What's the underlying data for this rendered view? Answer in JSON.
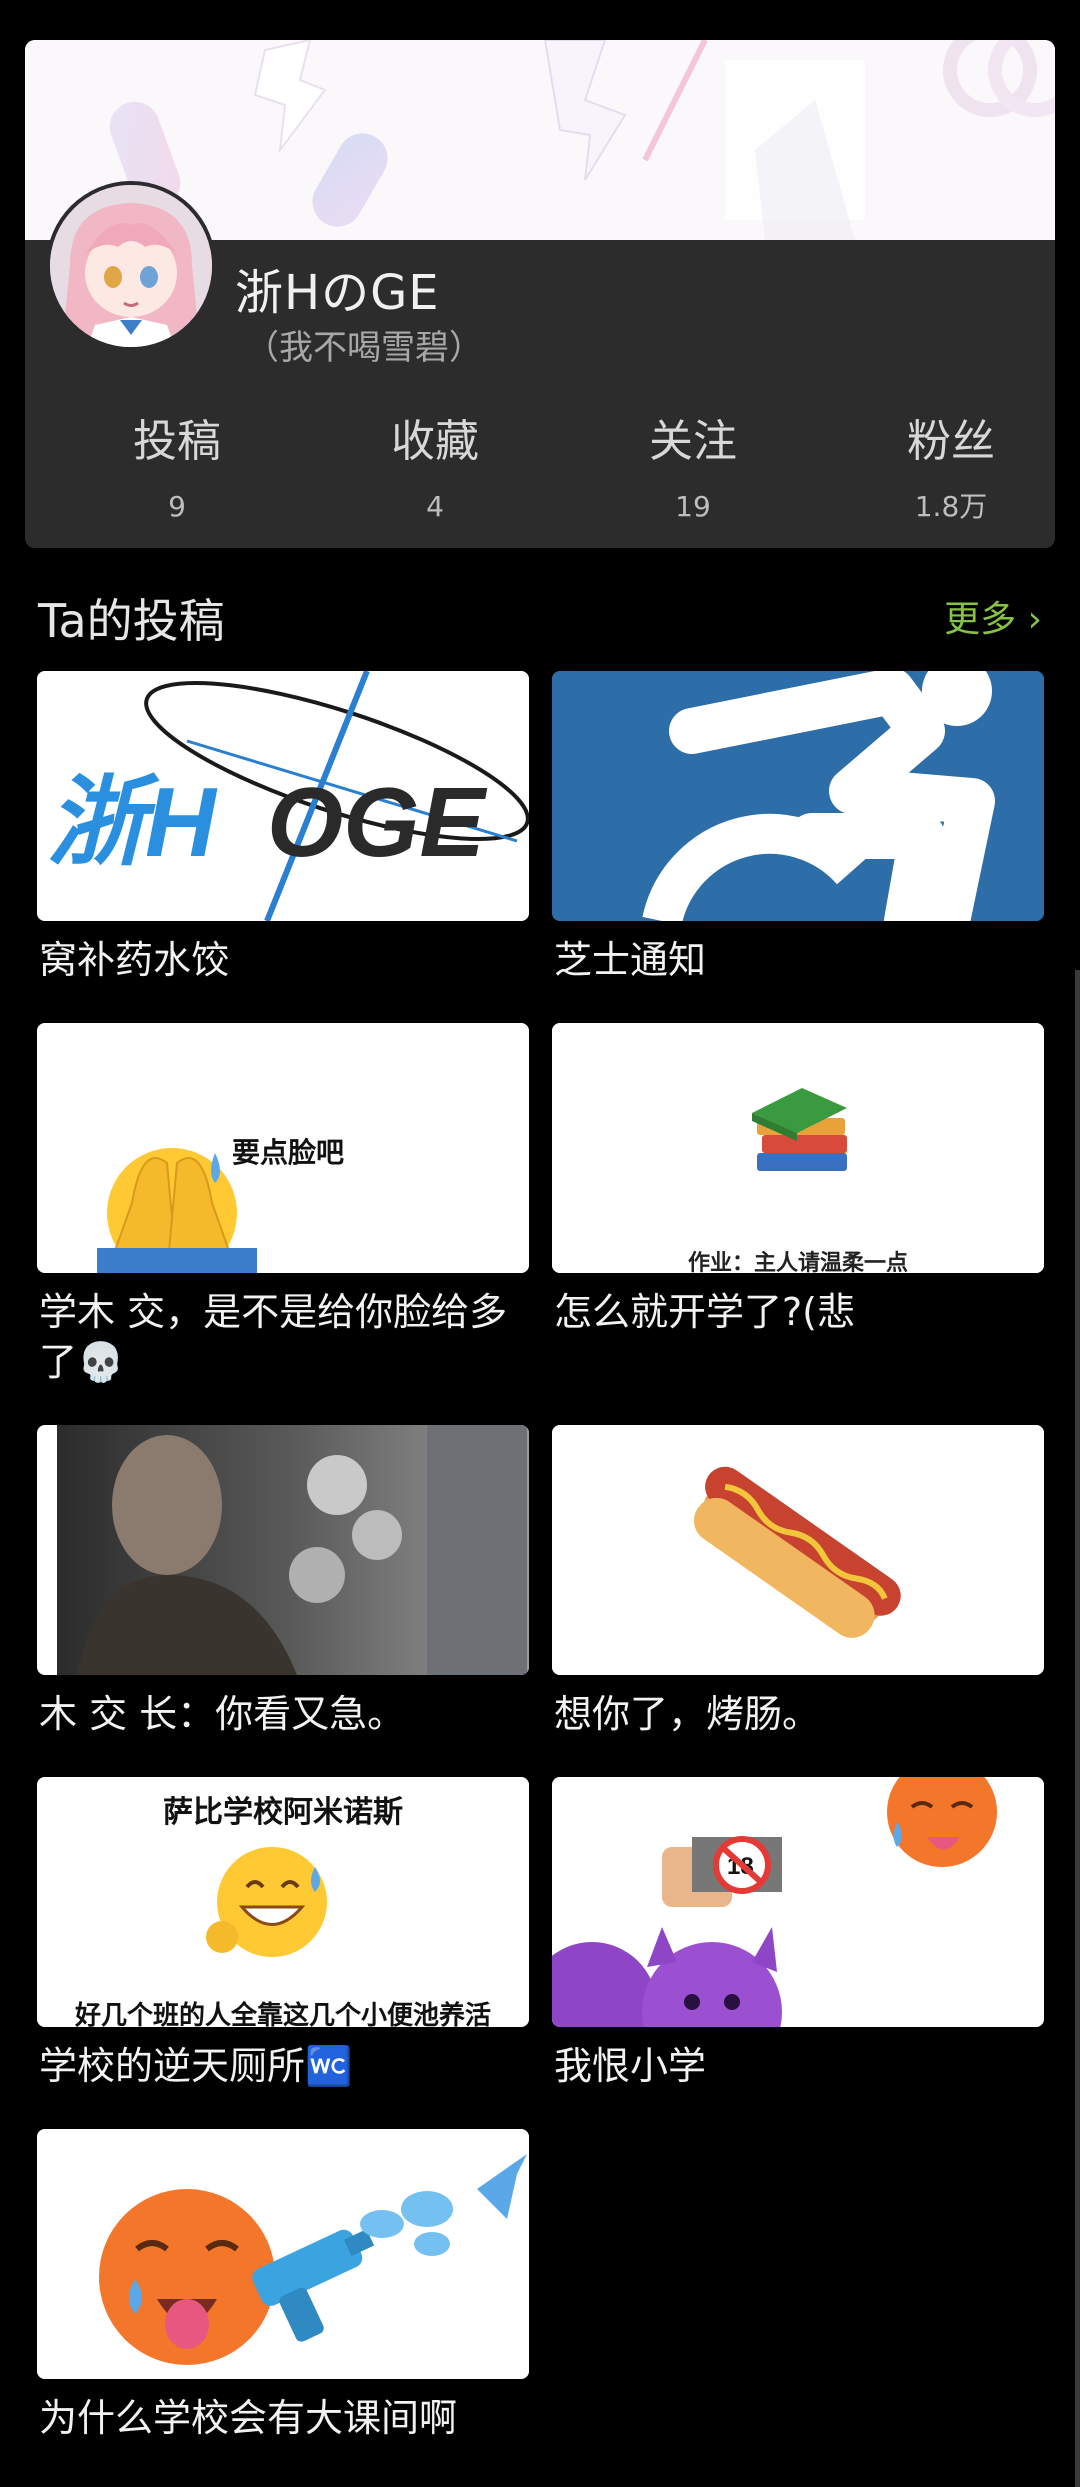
{
  "profile": {
    "username": "浙HのGE",
    "signature": "（我不喝雪碧）",
    "stats": [
      {
        "label": "投稿",
        "value": "9"
      },
      {
        "label": "收藏",
        "value": "4"
      },
      {
        "label": "关注",
        "value": "19"
      },
      {
        "label": "粉丝",
        "value": "1.8万"
      }
    ]
  },
  "section": {
    "title": "Ta的投稿",
    "more": "更多 ›"
  },
  "posts": [
    {
      "title": "窝补药水饺",
      "thumb_text": "浙HOGE"
    },
    {
      "title": "芝士通知",
      "thumb_text": ""
    },
    {
      "title": "学木 交，是不是给你脸给多了💀",
      "thumb_text": "要点脸吧"
    },
    {
      "title": "怎么就开学了?(悲",
      "thumb_text": "作业：主人请温柔一点"
    },
    {
      "title": "木 交 长：你看又急。",
      "thumb_text": ""
    },
    {
      "title": "想你了，烤肠。",
      "thumb_text": ""
    },
    {
      "title": "学校的逆天厕所🚾",
      "thumb_text": "萨比学校阿米诺斯",
      "thumb_text2": "好几个班的人全靠这几个小便池养活"
    },
    {
      "title": "我恨小学",
      "thumb_text": ""
    },
    {
      "title": "为什么学校会有大课间啊",
      "thumb_text": ""
    }
  ],
  "colors": {
    "background": "#000000",
    "card": "#2c2c2c",
    "accent": "#86c340",
    "wheelchair_blue": "#2d6ea8"
  }
}
